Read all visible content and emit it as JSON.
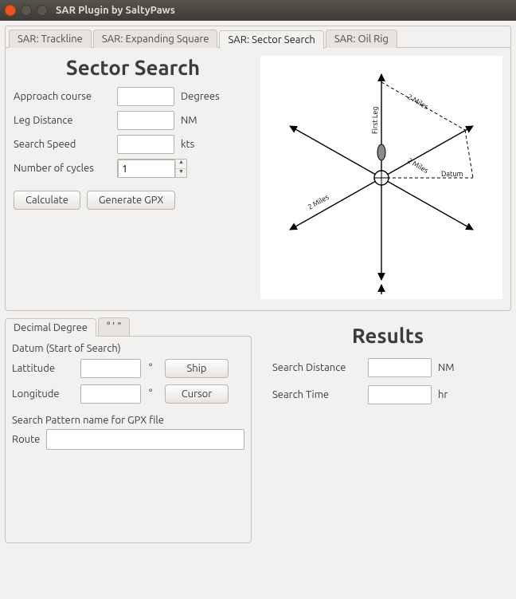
{
  "window": {
    "title": "SAR Plugin by SaltyPaws"
  },
  "tabs": {
    "items": [
      {
        "label": "SAR: Trackline"
      },
      {
        "label": "SAR: Expanding Square"
      },
      {
        "label": "SAR: Sector Search"
      },
      {
        "label": "SAR: Oil Rig"
      }
    ],
    "active_index": 2
  },
  "sector": {
    "heading": "Sector Search",
    "approach_label": "Approach course",
    "approach_value": "",
    "approach_unit": "Degrees",
    "leg_label": "Leg Distance",
    "leg_value": "",
    "leg_unit": "NM",
    "speed_label": "Search Speed",
    "speed_value": "",
    "speed_unit": "kts",
    "cycles_label": "Number of cycles",
    "cycles_value": "1",
    "calculate_label": "Calculate",
    "generate_label": "Generate GPX",
    "diagram": {
      "first_leg": "First Leg",
      "two_miles": "2 Miles",
      "datum": "Datum"
    }
  },
  "coord_tabs": {
    "items": [
      {
        "label": "Decimal Degree"
      },
      {
        "label": "° ' \""
      }
    ],
    "active_index": 0
  },
  "datum": {
    "section": "Datum (Start of Search)",
    "lat_label": "Lattitude",
    "lat_value": "",
    "lon_label": "Longitude",
    "lon_value": "",
    "deg_symbol": "°",
    "ship_label": "Ship",
    "cursor_label": "Cursor",
    "gpx_section": "Search Pattern name for GPX file",
    "route_label": "Route",
    "route_value": ""
  },
  "results": {
    "heading": "Results",
    "distance_label": "Search Distance",
    "distance_value": "",
    "distance_unit": "NM",
    "time_label": "Search Time",
    "time_value": "",
    "time_unit": "hr"
  }
}
